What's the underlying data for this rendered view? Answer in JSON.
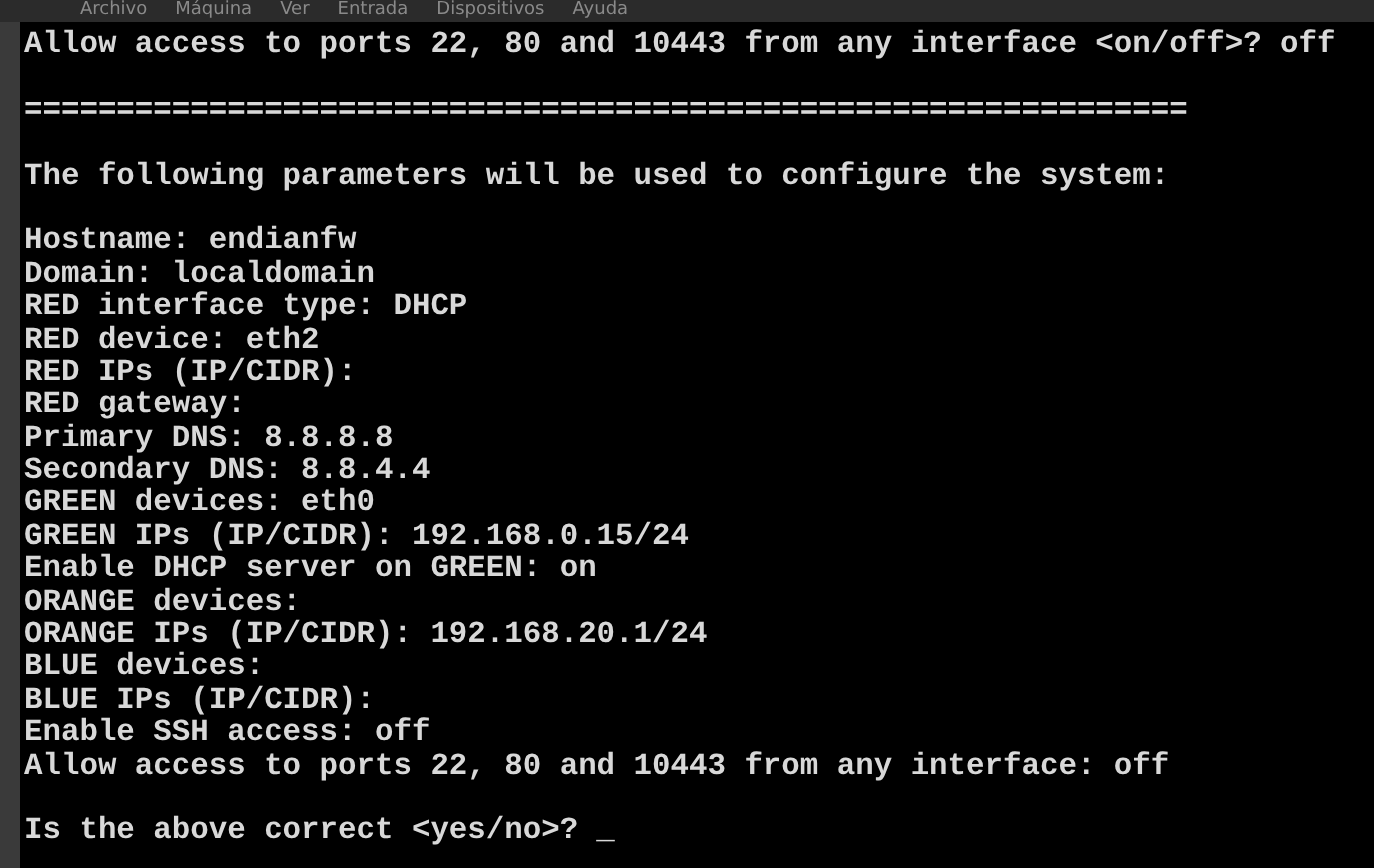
{
  "menu_bar": {
    "items": [
      "Archivo",
      "Máquina",
      "Ver",
      "Entrada",
      "Dispositivos",
      "Ayuda"
    ]
  },
  "console": {
    "lines": [
      {
        "text": "Allow access to ports 22, 80 and 10443 from any interface <on/off>? off",
        "gap_before": false
      },
      {
        "text": "===============================================================",
        "gap_before": true
      },
      {
        "text": "The following parameters will be used to configure the system:",
        "gap_before": true
      },
      {
        "text": "Hostname: endianfw",
        "gap_before": true
      },
      {
        "text": "Domain: localdomain",
        "gap_before": false
      },
      {
        "text": "RED interface type: DHCP",
        "gap_before": false
      },
      {
        "text": "RED device: eth2",
        "gap_before": false
      },
      {
        "text": "RED IPs (IP/CIDR):",
        "gap_before": false
      },
      {
        "text": "RED gateway:",
        "gap_before": false
      },
      {
        "text": "Primary DNS: 8.8.8.8",
        "gap_before": false
      },
      {
        "text": "Secondary DNS: 8.8.4.4",
        "gap_before": false
      },
      {
        "text": "GREEN devices: eth0",
        "gap_before": false
      },
      {
        "text": "GREEN IPs (IP/CIDR): 192.168.0.15/24",
        "gap_before": false
      },
      {
        "text": "Enable DHCP server on GREEN: on",
        "gap_before": false
      },
      {
        "text": "ORANGE devices:",
        "gap_before": false
      },
      {
        "text": "ORANGE IPs (IP/CIDR): 192.168.20.1/24",
        "gap_before": false
      },
      {
        "text": "BLUE devices:",
        "gap_before": false
      },
      {
        "text": "BLUE IPs (IP/CIDR):",
        "gap_before": false
      },
      {
        "text": "Enable SSH access: off",
        "gap_before": false
      },
      {
        "text": "Allow access to ports 22, 80 and 10443 from any interface: off",
        "gap_before": false
      }
    ],
    "prompt": {
      "text": "Is the above correct <yes/no>?",
      "cursor": "_",
      "gap_before": true
    }
  }
}
